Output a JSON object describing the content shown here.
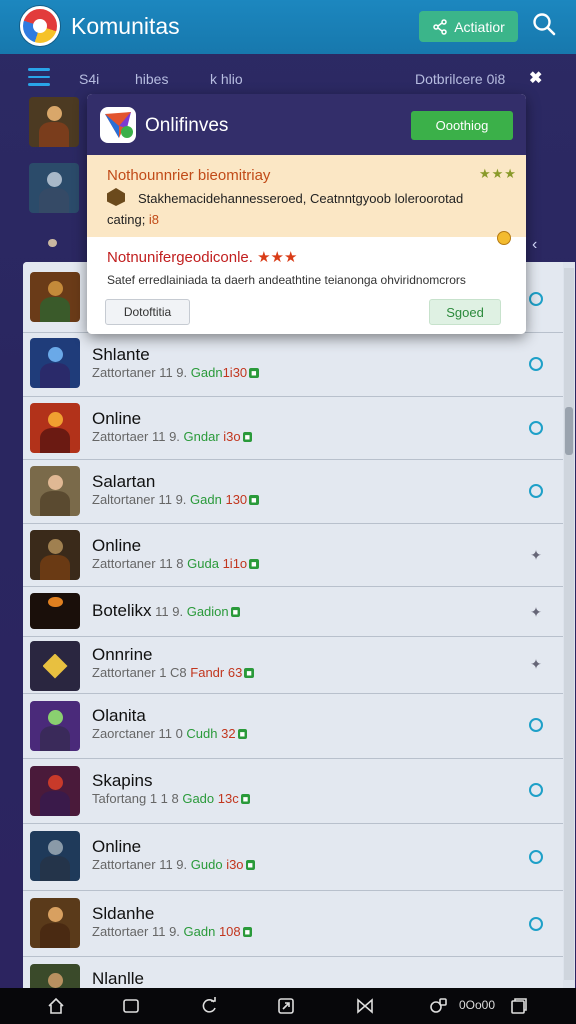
{
  "app": {
    "title": "Komunitas",
    "action_label": "Actiatior"
  },
  "subbar": {
    "item_a": "S4i",
    "item_b": "hibes",
    "item_c": "k  hlio",
    "right": "Dotbrilcere 0i8",
    "close": "✖"
  },
  "popup": {
    "title": "Onlifinves",
    "primary_label": "Ooothiog",
    "notice1": {
      "title": "Nothounnrier bieomitriay",
      "stars": "★★★",
      "body": "Stakhemacidehannesseroed, Ceatnntgyoob loleroorotad",
      "body2_prefix": "cating; ",
      "body2_hl": "i8"
    },
    "notice2": {
      "title": "Notnunifergeodiconle.",
      "stars": "★★★",
      "body": "Satef erredlainiada ta daerh andeathtine teianonga ohviridnomcrors",
      "left_label": "Dotoftitia",
      "right_label": "Sgoed"
    }
  },
  "list": [
    {
      "name": "",
      "meta_a": "",
      "meta_b": "",
      "meta_c": "",
      "status": "ring"
    },
    {
      "name": "Shlante",
      "meta_a": "Zattortaner 11 9. ",
      "meta_b": "Gadn",
      "meta_c": "1i30",
      "status": "ring"
    },
    {
      "name": "Online",
      "meta_a": "Zattortaer 11 9. ",
      "meta_b": "Gndar ",
      "meta_c": "i3o",
      "status": "ring"
    },
    {
      "name": "Salartan",
      "meta_a": "Zaltortaner 11 9. ",
      "meta_b": "Gadn ",
      "meta_c": "130",
      "status": "ring"
    },
    {
      "name": "Online",
      "meta_a": "Zattortaner 11 8 ",
      "meta_b": "Guda ",
      "meta_c": "1i1o",
      "status": "star"
    },
    {
      "name": "Botelikx",
      "meta_a": " 11 9. ",
      "meta_b": "Gadion",
      "meta_c": "",
      "status": "star"
    },
    {
      "name": "Onnrine",
      "meta_a": "Zattortaner 1 C8 ",
      "meta_b": "Fandr ",
      "meta_c": "63",
      "status": "star"
    },
    {
      "name": "Olanita",
      "meta_a": "Zaorctaner 11 0 ",
      "meta_b": "Cudh ",
      "meta_c": "32",
      "status": "ring"
    },
    {
      "name": "Skapins",
      "meta_a": "Tafortang 1 1 8 ",
      "meta_b": "Gado ",
      "meta_c": "13c",
      "status": "ring"
    },
    {
      "name": "Online",
      "meta_a": "Zattortaner 11 9. ",
      "meta_b": "Gudo ",
      "meta_c": "i3o",
      "status": "ring"
    },
    {
      "name": "Sldanhe",
      "meta_a": "Zattortaer 11 9. ",
      "meta_b": "Gadn ",
      "meta_c": "108",
      "status": "ring"
    },
    {
      "name": "Nlanlle",
      "meta_a": "",
      "meta_b": "",
      "meta_c": "",
      "status": "none"
    }
  ],
  "navbar": {
    "text": "0Oo00"
  },
  "colors": {
    "appbar": "#1b84bb",
    "accent_green": "#3bb58a",
    "popup_header": "#332e6a",
    "notice_bg": "#fbe7c5",
    "status_ring": "#1ea0c8"
  },
  "icons": [
    "app-logo-icon",
    "share-icon",
    "search-icon",
    "menu-icon",
    "close-icon",
    "home-icon",
    "square-icon",
    "refresh-icon",
    "expand-icon",
    "bowtie-icon",
    "apps-icon",
    "window-icon"
  ]
}
